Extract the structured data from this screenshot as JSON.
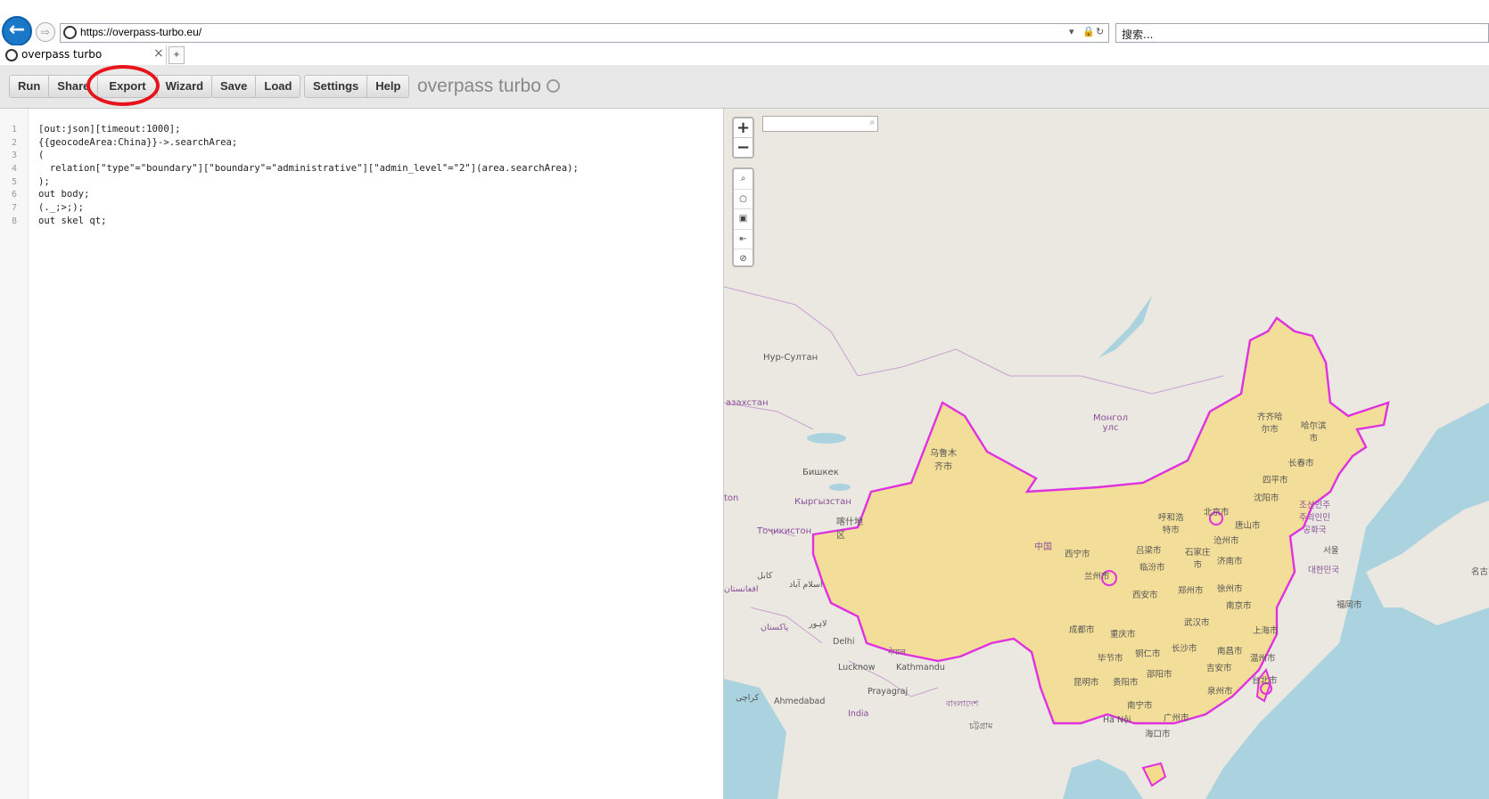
{
  "browser": {
    "url": "https://overpass-turbo.eu/",
    "search_placeholder": "搜索...",
    "tab_title": "overpass turbo",
    "tab_close": "×",
    "back_icon": "←",
    "forward_icon": "⇨"
  },
  "toolbar": {
    "run": "Run",
    "share": "Share",
    "export": "Export",
    "wizard": "Wizard",
    "save": "Save",
    "load": "Load",
    "settings": "Settings",
    "help": "Help",
    "logo": "overpass turbo",
    "highlight_color": "#e8141c"
  },
  "editor": {
    "line_numbers": [
      "1",
      "2",
      "3",
      "4",
      "5",
      "6",
      "7",
      "8"
    ],
    "lines": [
      "[out:json][timeout:1000];",
      "{{geocodeArea:China}}->.searchArea;",
      "(",
      "  relation[\"type\"=\"boundary\"][\"boundary\"=\"administrative\"][\"admin_level\"=\"2\"](area.searchArea);",
      ");",
      "out body;",
      "(._;>;);",
      "out skel qt;"
    ]
  },
  "map": {
    "zoom_in": "+",
    "zoom_out": "−",
    "tools": [
      "⌕",
      "○",
      "▣",
      "⇤",
      "⊘"
    ],
    "search_icon": "⌕",
    "highlight_fill": "#f5dc8c",
    "highlight_border": "#e031e0",
    "labels": {
      "nur_sultan": "Нур-Султан",
      "kazakhstan": "азахстан",
      "mongolia": "Монгол\nулс",
      "urumqi": "乌鲁木\n齐市",
      "bishkek": "Бишкек",
      "kyrgyzstan": "Кыргызстан",
      "tajikistan": "Тоҷикистон",
      "kashi": "喀什地\n区",
      "zhongguo": "中国",
      "xining": "西宁市",
      "lanzhou": "兰州市",
      "xian": "西安市",
      "hohhot": "呼和浩\n特市",
      "beijing": "北京市",
      "tangshan": "唐山市",
      "shenyang": "沈阳市",
      "siping": "四平市",
      "changchun": "长春市",
      "harbin": "哈尔滨\n市",
      "qiqihar": "齐齐哈\n尔市",
      "luliang": "吕梁市",
      "linfen": "临汾市",
      "shijiazhuang": "石家庄\n市",
      "cangzhou": "沧州市",
      "jinan": "济南市",
      "zhengzhou": "郑州市",
      "xuzhou": "徐州市",
      "nanjing": "南京市",
      "shanghai": "上海市",
      "wuhan": "武汉市",
      "chengdu": "成都市",
      "chongqing": "重庆市",
      "bijie": "毕节市",
      "tongren": "铜仁市",
      "changsha": "长沙市",
      "nanchang": "南昌市",
      "shaoyang": "邵阳市",
      "jian": "吉安市",
      "wenzhou": "温州市",
      "kunming": "昆明市",
      "guiyang": "贵阳市",
      "quanzhou": "泉州市",
      "taibei": "台北市",
      "nanning": "南宁市",
      "guangzhou": "广州市",
      "haikou": "海口市",
      "hanoi": "Hà Nội",
      "korea_north": "조선민주\n주의인민\n공화국",
      "seoul": "서울",
      "korea_south": "대한민국",
      "fukuoka": "福岡市",
      "kabul": "کابل",
      "afghanistan": "افغانستان",
      "islamabad": "اسلام آباد",
      "lahore": "لاہور",
      "pakistan": "پاکستان",
      "delhi": "Delhi",
      "lucknow": "Lucknow",
      "kathmandu": "Kathmandu",
      "nepal": "नेपाल",
      "prayagraj": "Prayagraj",
      "ahmedabad": "Ahmedabad",
      "karachi": "کراچی",
      "india": "India",
      "bangladesh": "বাংলাদেশ",
      "chittagong": "চট্টগ্রাম",
      "ton": "ton",
      "mingzi": "名古"
    }
  }
}
